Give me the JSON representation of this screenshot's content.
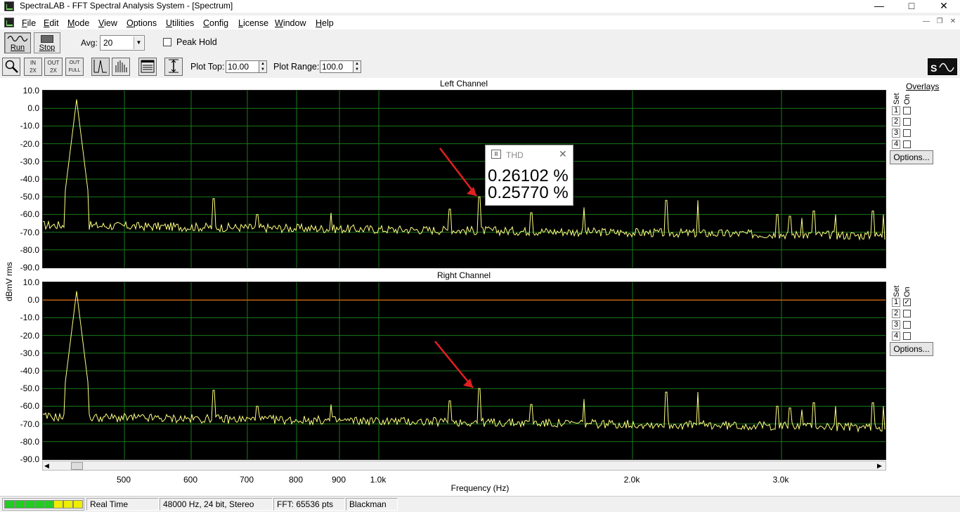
{
  "window": {
    "title": "SpectraLAB - FFT Spectral Analysis System - [Spectrum]"
  },
  "menu": [
    "File",
    "Edit",
    "Mode",
    "View",
    "Options",
    "Utilities",
    "Config",
    "License",
    "Window",
    "Help"
  ],
  "toolbar": {
    "run_label": "Run",
    "stop_label": "Stop",
    "avg_label": "Avg:",
    "avg_value": "20",
    "peak_hold_label": "Peak Hold",
    "plot_top_label": "Plot Top:",
    "plot_top_value": "10.00",
    "plot_range_label": "Plot Range:",
    "plot_range_value": "100.0",
    "zoom_in_label": "IN\n2X",
    "zoom_out_label": "OUT\n2X",
    "zoom_full_label": "OUT\nFULL"
  },
  "plot": {
    "left_title": "Left Channel",
    "right_title": "Right Channel",
    "ylabel": "dBmV rms",
    "xlabel": "Frequency (Hz)",
    "yticks": [
      "10.0",
      "0.0",
      "-10.0",
      "-20.0",
      "-30.0",
      "-40.0",
      "-50.0",
      "-60.0",
      "-70.0",
      "-80.0",
      "-90.0"
    ],
    "xticks": [
      "500",
      "600",
      "700",
      "800",
      "900",
      "1.0k",
      "2.0k",
      "3.0k"
    ]
  },
  "overlays": {
    "title": "Overlays",
    "set_label": "Set",
    "on_label": "On",
    "nums": [
      "1",
      "2",
      "3",
      "4"
    ],
    "options_label": "Options...",
    "right_checked": [
      true,
      false,
      false,
      false
    ],
    "left_checked": [
      false,
      false,
      false,
      false
    ]
  },
  "thd": {
    "title": "THD",
    "value1": "0.26102 %",
    "value2": "0.25770 %"
  },
  "status": {
    "mode": "Real Time",
    "format": "48000 Hz, 24 bit, Stereo",
    "fft": "FFT: 65536 pts",
    "window": "Blackman"
  },
  "colors": {
    "trace": "#ffff80",
    "grid": "#1a7a1a",
    "overlay_line": "#c06010",
    "arrow": "#e02020",
    "vu_green": "#22cc22",
    "vu_yellow": "#eeee00"
  }
}
